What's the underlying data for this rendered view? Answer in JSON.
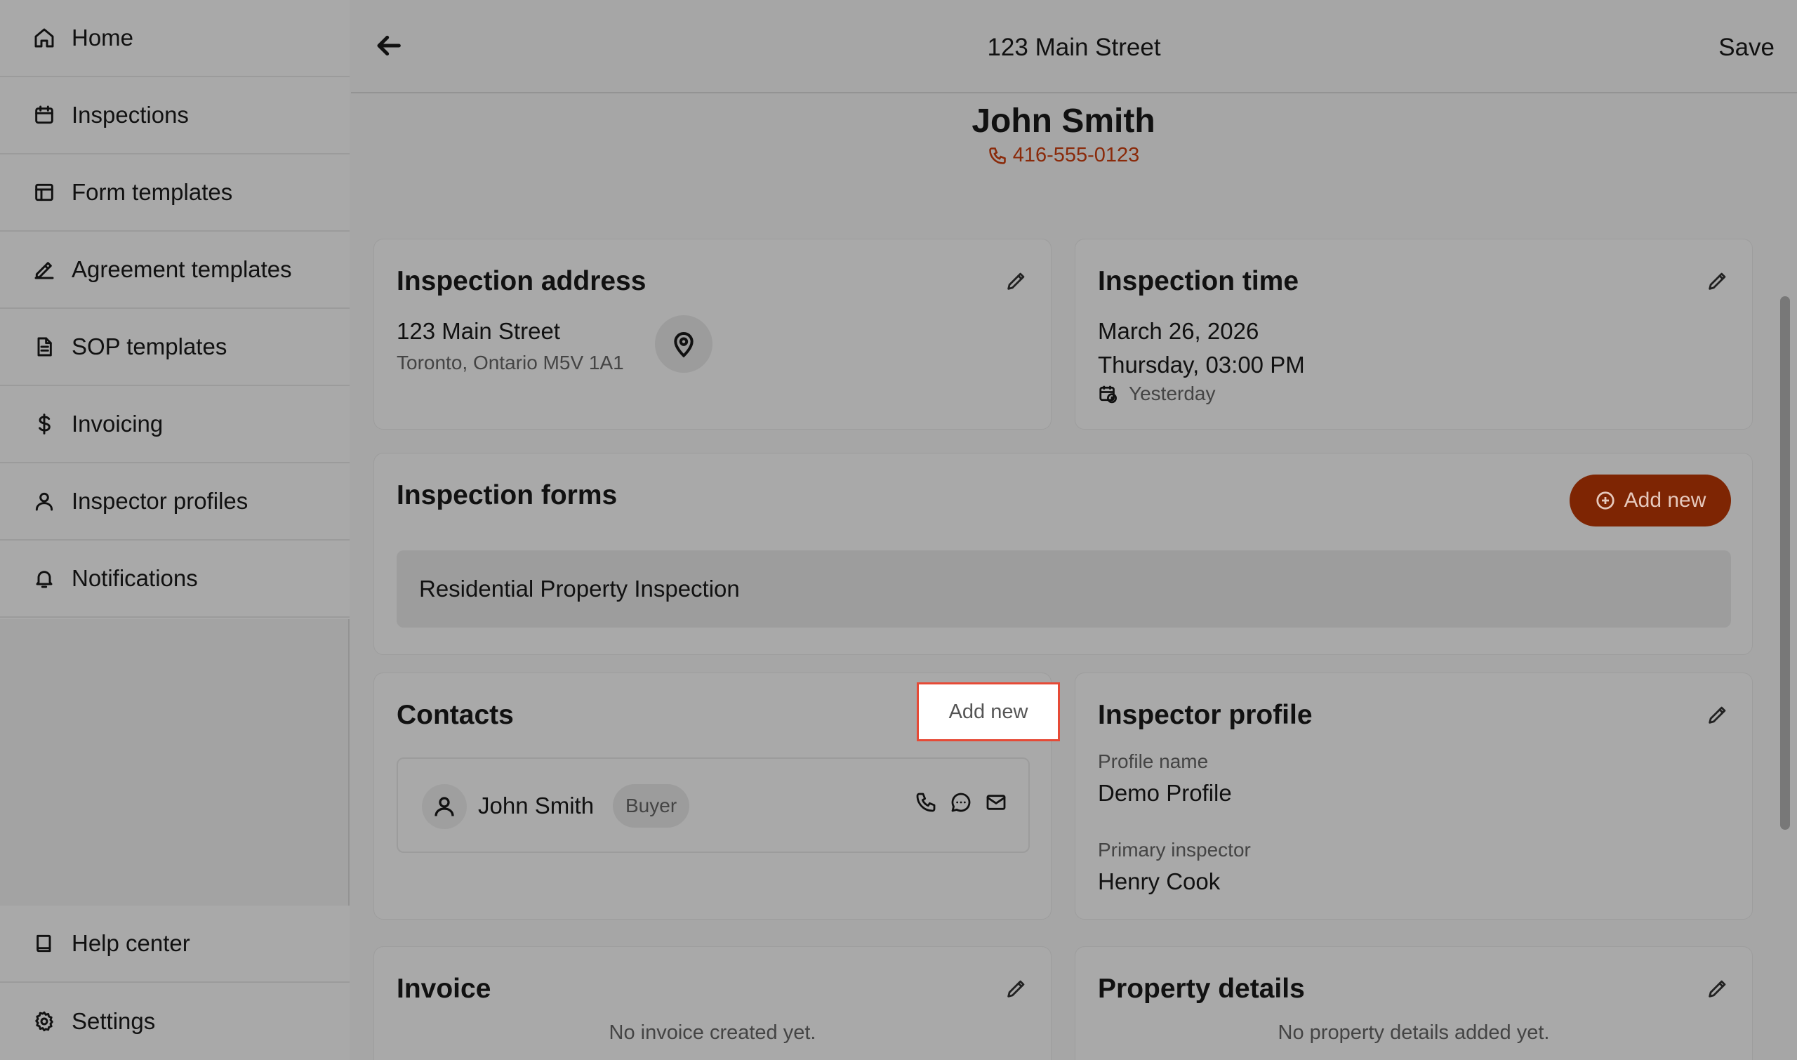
{
  "sidebar": {
    "top_items": [
      {
        "label": "Home",
        "icon": "home-icon"
      },
      {
        "label": "Inspections",
        "icon": "calendar-icon"
      },
      {
        "label": "Form templates",
        "icon": "layout-icon"
      },
      {
        "label": "Agreement templates",
        "icon": "signature-icon"
      },
      {
        "label": "SOP templates",
        "icon": "document-icon"
      },
      {
        "label": "Invoicing",
        "icon": "dollar-icon"
      },
      {
        "label": "Inspector profiles",
        "icon": "user-icon"
      },
      {
        "label": "Notifications",
        "icon": "bell-icon"
      }
    ],
    "bottom_items": [
      {
        "label": "Help center",
        "icon": "book-icon"
      },
      {
        "label": "Settings",
        "icon": "gear-icon"
      }
    ]
  },
  "header": {
    "title": "123 Main Street",
    "save_label": "Save"
  },
  "client": {
    "name": "John Smith",
    "phone": "416-555-0123"
  },
  "address_card": {
    "title": "Inspection address",
    "line1": "123 Main Street",
    "line2": "Toronto, Ontario M5V 1A1"
  },
  "time_card": {
    "title": "Inspection time",
    "date": "March 26, 2026",
    "day_time": "Thursday, 03:00 PM",
    "relative": "Yesterday"
  },
  "forms_card": {
    "title": "Inspection forms",
    "add_label": "Add new",
    "forms": [
      "Residential Property Inspection"
    ]
  },
  "contacts_card": {
    "title": "Contacts",
    "add_label": "Add new",
    "contacts": [
      {
        "name": "John Smith",
        "role": "Buyer"
      }
    ]
  },
  "inspector_card": {
    "title": "Inspector profile",
    "profile_name_label": "Profile name",
    "profile_name": "Demo Profile",
    "primary_inspector_label": "Primary inspector",
    "primary_inspector": "Henry Cook"
  },
  "invoice_card": {
    "title": "Invoice",
    "empty": "No invoice created yet."
  },
  "property_card": {
    "title": "Property details",
    "empty": "No property details added yet."
  },
  "colors": {
    "accent": "#7e2503",
    "phone_link": "#8a2a0a",
    "highlight_border": "#e64a36"
  }
}
